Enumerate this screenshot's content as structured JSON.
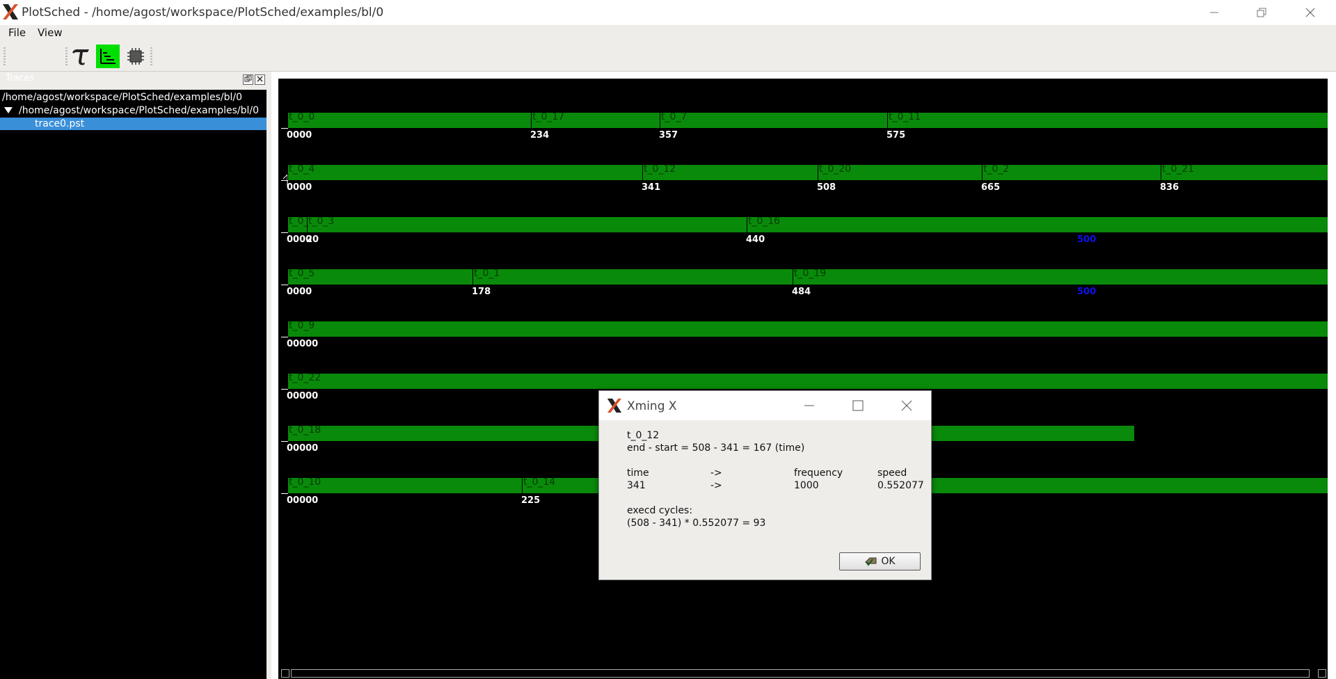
{
  "window": {
    "title": "PlotSched - /home/agost/workspace/PlotSched/examples/bl/0"
  },
  "menubar": {
    "file": "File",
    "view": "View"
  },
  "toolbar": {
    "tools": [
      "tau-tool-icon",
      "gantt-view-icon",
      "cpu-view-icon"
    ],
    "active_color": "#00e000"
  },
  "traces_pane": {
    "title": "Traces",
    "root_path": "/home/agost/workspace/PlotSched/examples/bl/0",
    "folder": "/home/agost/workspace/PlotSched/examples/bl/0",
    "selected_file": "trace0.pst"
  },
  "plot": {
    "rows": [
      {
        "tasks": [
          {
            "name": "t_0_0",
            "start": "0000"
          },
          {
            "name": "t_0_17",
            "start": "234"
          },
          {
            "name": "t_0_7",
            "start": "357"
          },
          {
            "name": "t_0_11",
            "start": "575"
          }
        ],
        "extra": []
      },
      {
        "tasks": [
          {
            "name": "t_0_4",
            "start": "0000"
          },
          {
            "name": "t_0_12",
            "start": "341"
          },
          {
            "name": "t_0_20",
            "start": "508"
          },
          {
            "name": "t_0_2",
            "start": "665"
          },
          {
            "name": "t_0_21",
            "start": "836"
          }
        ],
        "extra": []
      },
      {
        "tasks": [
          {
            "name": "t_0_",
            "start": "0000"
          },
          {
            "name": "t_0_3",
            "start": "20"
          },
          {
            "name": "t_0_16",
            "start": "440"
          }
        ],
        "extra": [
          {
            "text": "500"
          }
        ]
      },
      {
        "tasks": [
          {
            "name": "t_0_5",
            "start": "0000"
          },
          {
            "name": "t_0_1",
            "start": "178"
          },
          {
            "name": "t_0_19",
            "start": "484"
          }
        ],
        "extra": [
          {
            "text": "500"
          }
        ]
      },
      {
        "tasks": [
          {
            "name": "t_0_9",
            "start": "00000"
          }
        ],
        "extra": []
      },
      {
        "tasks": [
          {
            "name": "t_0_22",
            "start": "00000"
          }
        ],
        "extra": []
      },
      {
        "tasks": [
          {
            "name": "t_0_18",
            "start": "00000"
          }
        ],
        "extra": []
      },
      {
        "tasks": [
          {
            "name": "t_0_10",
            "start": "00000"
          },
          {
            "name": "t_0_14",
            "start": "225"
          }
        ],
        "extra": []
      }
    ]
  },
  "dialog": {
    "title": "Xming X",
    "task": "t_0_12",
    "duration_line": "end - start = 508 - 341 = 167 (time)",
    "headers": {
      "time": "time",
      "arrow": "->",
      "frequency": "frequency",
      "speed": "speed"
    },
    "values": {
      "time": "341",
      "arrow": "->",
      "frequency": "1000",
      "speed": "0.552077"
    },
    "cycles_label": "execd cycles:",
    "cycles_formula": "(508 - 341) * 0.552077  = 93",
    "ok_label": "OK"
  }
}
